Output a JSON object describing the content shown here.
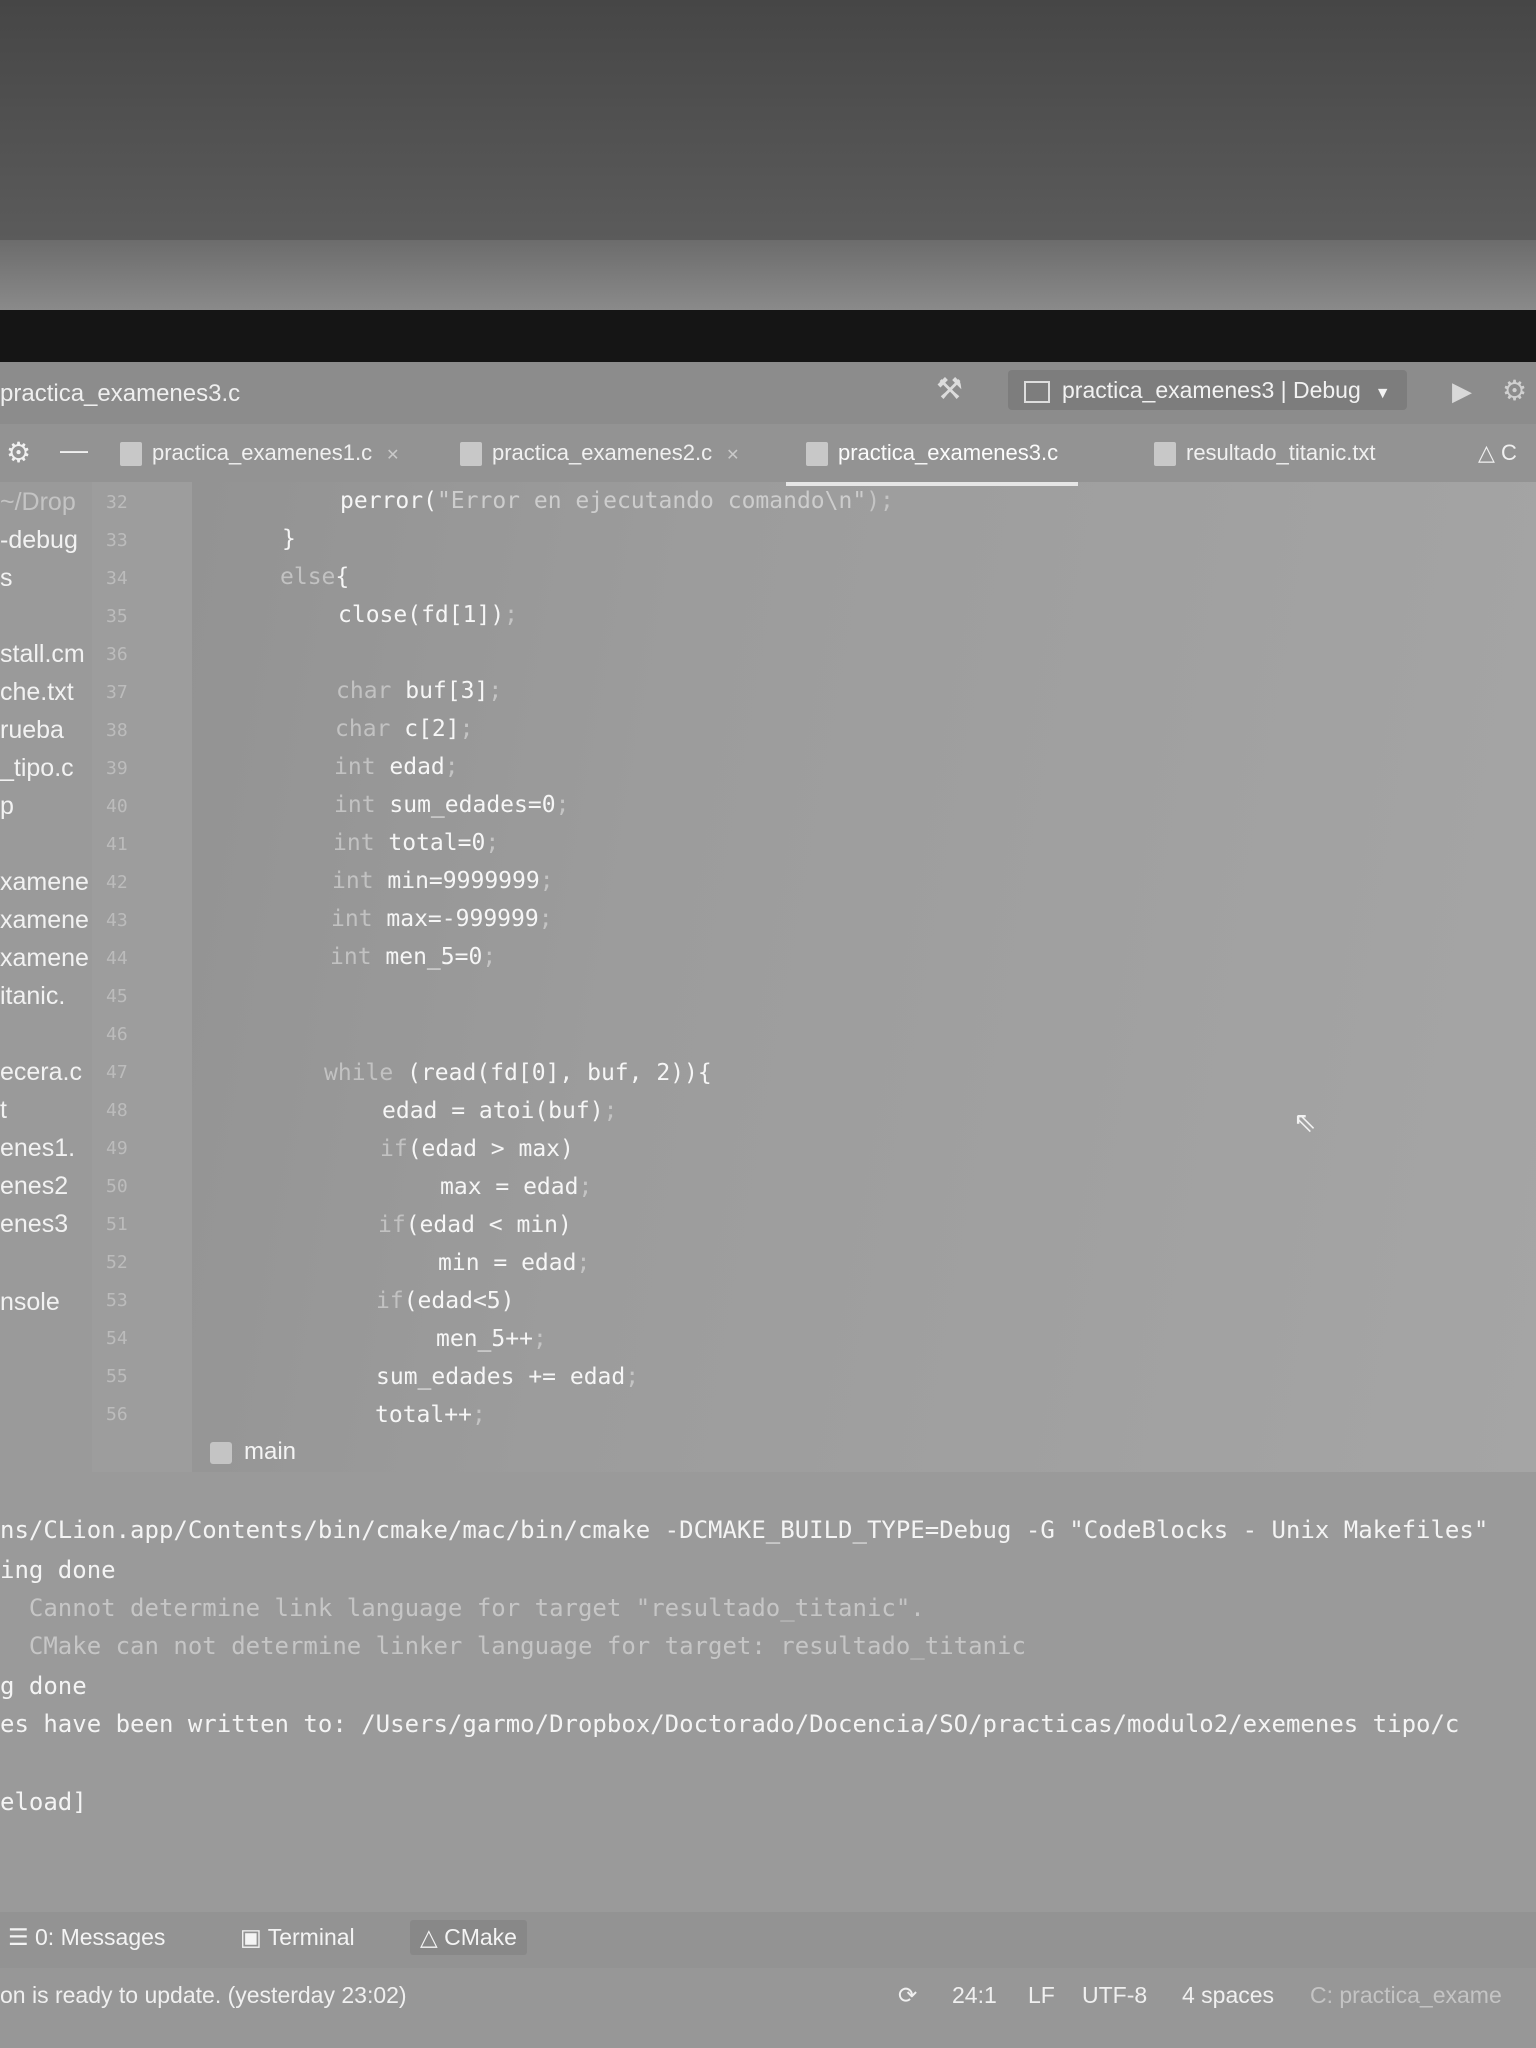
{
  "window": {
    "title": "practica_examenes3.c",
    "run_config": "practica_examenes3 | Debug"
  },
  "tabs": [
    {
      "label": "practica_examenes1.c"
    },
    {
      "label": "practica_examenes2.c"
    },
    {
      "label": "practica_examenes3.c",
      "active": true
    },
    {
      "label": "resultado_titanic.txt"
    },
    {
      "label": "C"
    }
  ],
  "sidebar_fragments": [
    "~/Drop",
    "-debug",
    "s",
    "stall.cm",
    "che.txt",
    "rueba",
    "_tipo.c",
    "p",
    "xamene",
    "xamene",
    "xamene",
    "itanic.",
    "ecera.c",
    "t",
    "enes1.",
    "enes2",
    "enes3",
    "nsole"
  ],
  "line_numbers": [
    "32",
    "33",
    "34",
    "35",
    "36",
    "37",
    "38",
    "39",
    "40",
    "41",
    "42",
    "43",
    "44",
    "45",
    "46",
    "47",
    "48",
    "49",
    "50",
    "51",
    "52",
    "53",
    "54",
    "55",
    "56"
  ],
  "code": {
    "l32_fn": "perror(",
    "l32_str": "\"Error en ejecutando comando\\n\"",
    "l32_end": ");",
    "l33": "}",
    "l34_kw": "else",
    "l34_end": "{",
    "l35": "close(fd[1])",
    "l37_kw": "char",
    "l37": " buf[3]",
    "l38_kw": "char",
    "l38": " c[2]",
    "l39_kw": "int",
    "l39": " edad",
    "l40_kw": "int",
    "l40": " sum_edades=0",
    "l41_kw": "int",
    "l41": " total=0",
    "l42_kw": "int",
    "l42": " min=9999999",
    "l43_kw": "int",
    "l43": " max=-999999",
    "l44_kw": "int",
    "l44": " men_5=0",
    "l47_kw": "while",
    "l47": " (read(fd[0], buf, 2)){",
    "l48": "edad = atoi(buf)",
    "l49_kw": "if",
    "l49": "(edad > max)",
    "l50": "max = edad",
    "l51_kw": "if",
    "l51": "(edad < min)",
    "l52": "min = edad",
    "l53_kw": "if",
    "l53": "(edad<5)",
    "l54": "men_5++",
    "l55": "sum_edades += edad",
    "l56": "total++",
    "semicolon": ";"
  },
  "breadcrumb": "main",
  "console": [
    "ns/CLion.app/Contents/bin/cmake/mac/bin/cmake -DCMAKE_BUILD_TYPE=Debug -G \"CodeBlocks - Unix Makefiles\"",
    "ing done",
    "  Cannot determine link language for target \"resultado_titanic\".",
    "  CMake can not determine linker language for target: resultado_titanic",
    "g done",
    "es have been written to: /Users/garmo/Dropbox/Doctorado/Docencia/SO/practicas/modulo2/exemenes tipo/c",
    "",
    "eload]"
  ],
  "tool_windows": {
    "messages": "0: Messages",
    "terminal": "Terminal",
    "cmake": "CMake"
  },
  "status": {
    "message": "on is ready to update. (yesterday 23:02)",
    "position": "24:1",
    "line_sep": "LF",
    "encoding": "UTF-8",
    "indent": "4 spaces",
    "context": "C: practica_exame"
  }
}
